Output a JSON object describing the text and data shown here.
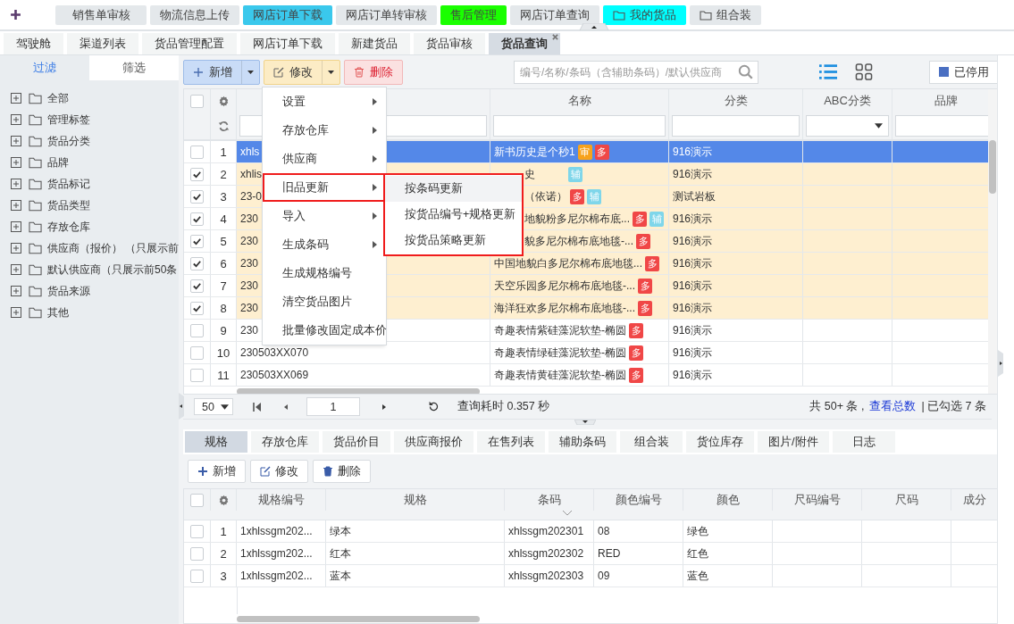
{
  "top_tabs": [
    {
      "label": "销售单审核",
      "kind": "plain",
      "color": "#e4e8eb"
    },
    {
      "label": "物流信息上传",
      "kind": "plain",
      "color": "#e4e8eb"
    },
    {
      "label": "网店订单下载",
      "kind": "plain",
      "color": "#3ac8ec"
    },
    {
      "label": "网店订单转审核",
      "kind": "plain",
      "color": "#e4e8eb"
    },
    {
      "label": "售后管理",
      "kind": "plain",
      "color": "#1aff00"
    },
    {
      "label": "网店订单查询",
      "kind": "plain",
      "color": "#e4e8eb"
    },
    {
      "label": "我的货品",
      "kind": "folder",
      "color": "#00ffff"
    },
    {
      "label": "组合装",
      "kind": "folder",
      "color": "#e4e8eb"
    }
  ],
  "page_tabs": [
    {
      "label": "驾驶舱",
      "selected": false
    },
    {
      "label": "渠道列表",
      "selected": false
    },
    {
      "label": "货品管理配置",
      "selected": false
    },
    {
      "label": "网店订单下载",
      "selected": false
    },
    {
      "label": "新建货品",
      "selected": false
    },
    {
      "label": "货品审核",
      "selected": false
    },
    {
      "label": "货品查询",
      "selected": true
    }
  ],
  "sidebar": {
    "tabs": [
      {
        "label": "过滤",
        "selected": true
      },
      {
        "label": "筛选",
        "selected": false
      }
    ],
    "tree": [
      {
        "label": "全部",
        "expanded": false
      },
      {
        "label": "管理标签",
        "expanded": false
      },
      {
        "label": "货品分类",
        "expanded": false
      },
      {
        "label": "品牌",
        "expanded": false
      },
      {
        "label": "货品标记",
        "expanded": false
      },
      {
        "label": "货品类型",
        "expanded": false
      },
      {
        "label": "存放仓库",
        "expanded": false
      },
      {
        "label": "供应商（报价） （只展示前",
        "expanded": false
      },
      {
        "label": "默认供应商（只展示前50条",
        "expanded": false
      },
      {
        "label": "货品来源",
        "expanded": false
      },
      {
        "label": "其他",
        "expanded": false
      }
    ]
  },
  "toolbar": {
    "buttons": [
      {
        "label": "新增",
        "kind": "add",
        "dropdown": true
      },
      {
        "label": "修改",
        "kind": "edit",
        "dropdown": true
      },
      {
        "label": "删除",
        "kind": "delete",
        "dropdown": false
      }
    ],
    "search": {
      "placeholder": "编号/名称/条码（含辅助条码）/默认供应商"
    },
    "view_modes": [
      {
        "kind": "list",
        "selected": true
      },
      {
        "kind": "grid",
        "selected": false
      }
    ],
    "disabled_toggle": {
      "label": "已停用",
      "checked": true
    }
  },
  "grid": {
    "all_checked": false,
    "columns": [
      {
        "kind": "text"
      },
      {
        "label": "名称",
        "kind": "text"
      },
      {
        "label": "分类",
        "kind": "text"
      },
      {
        "label": "ABC分类",
        "kind": "select"
      },
      {
        "label": "品牌",
        "kind": "text"
      }
    ],
    "rows": [
      {
        "no": "1",
        "code": "xhls",
        "name": "新书历史是个秒1",
        "badges": [
          {
            "label": "审",
            "color": "#f7a21b"
          },
          {
            "label": "多",
            "color": "#f04747"
          }
        ],
        "category": "916演示",
        "checked": false,
        "selected": true
      },
      {
        "no": "2",
        "code": "xhlis",
        "name": "史",
        "badges": [
          {
            "label": "辅",
            "color": "#7fd6ea"
          }
        ],
        "category": "916演示",
        "checked": true,
        "selected": false
      },
      {
        "no": "3",
        "code": "23-0",
        "name": "（依诺）",
        "badges": [
          {
            "label": "多",
            "color": "#f04747"
          },
          {
            "label": "辅",
            "color": "#7fd6ea"
          }
        ],
        "category": "测试岩板",
        "checked": true,
        "selected": false
      },
      {
        "no": "4",
        "code": "230",
        "name": "地貌粉多尼尔棉布底...",
        "badges": [
          {
            "label": "多",
            "color": "#f04747"
          },
          {
            "label": "辅",
            "color": "#7fd6ea"
          }
        ],
        "category": "916演示",
        "checked": true,
        "selected": false
      },
      {
        "no": "5",
        "code": "230",
        "name": "貌多尼尔棉布底地毯-...",
        "badges": [
          {
            "label": "多",
            "color": "#f04747"
          }
        ],
        "category": "916演示",
        "checked": true,
        "selected": false
      },
      {
        "no": "6",
        "code": "230",
        "name": "中国地貌白多尼尔棉布底地毯...",
        "badges": [
          {
            "label": "多",
            "color": "#f04747"
          }
        ],
        "category": "916演示",
        "checked": true,
        "selected": false
      },
      {
        "no": "7",
        "code": "230",
        "name": "天空乐园多尼尔棉布底地毯-...",
        "badges": [
          {
            "label": "多",
            "color": "#f04747"
          }
        ],
        "category": "916演示",
        "checked": true,
        "selected": false
      },
      {
        "no": "8",
        "code": "230",
        "name": "海洋狂欢多尼尔棉布底地毯-...",
        "badges": [
          {
            "label": "多",
            "color": "#f04747"
          }
        ],
        "category": "916演示",
        "checked": true,
        "selected": false
      },
      {
        "no": "9",
        "code": "230",
        "name": "奇趣表情紫硅藻泥软垫-椭圆",
        "badges": [
          {
            "label": "多",
            "color": "#f04747"
          }
        ],
        "category": "916演示",
        "checked": false,
        "selected": false
      },
      {
        "no": "10",
        "code": "230503XX070",
        "name": "奇趣表情绿硅藻泥软垫-椭圆",
        "badges": [
          {
            "label": "多",
            "color": "#f04747"
          }
        ],
        "category": "916演示",
        "checked": false,
        "selected": false
      },
      {
        "no": "11",
        "code": "230503XX069",
        "name": "奇趣表情黄硅藻泥软垫-椭圆",
        "badges": [
          {
            "label": "多",
            "color": "#f04747"
          }
        ],
        "category": "916演示",
        "checked": false,
        "selected": false
      }
    ]
  },
  "context_menu": {
    "items": [
      {
        "label": "设置",
        "submenu": true,
        "highlighted": false
      },
      {
        "label": "存放仓库",
        "submenu": true,
        "highlighted": false
      },
      {
        "label": "供应商",
        "submenu": true,
        "highlighted": false
      },
      {
        "label": "旧品更新",
        "submenu": true,
        "highlighted": true
      },
      {
        "label": "导入",
        "submenu": true,
        "highlighted": false
      },
      {
        "label": "生成条码",
        "submenu": true,
        "highlighted": false
      },
      {
        "label": "生成规格编号",
        "submenu": false,
        "highlighted": false
      },
      {
        "label": "清空货品图片",
        "submenu": false,
        "highlighted": false
      },
      {
        "label": "批量修改固定成本价",
        "submenu": false,
        "highlighted": false
      }
    ]
  },
  "submenu": {
    "highlighted": true,
    "items": [
      {
        "label": "按条码更新",
        "hovered": true
      },
      {
        "label": "按货品编号+规格更新",
        "hovered": false
      },
      {
        "label": "按货品策略更新",
        "hovered": false
      }
    ]
  },
  "pager": {
    "page_size": "50",
    "page": "1",
    "query_time": "查询耗时 0.357 秒",
    "total": "共 50+ 条 ,",
    "total_link": "查看总数",
    "checked_count": "| 已勾选 7 条"
  },
  "detail_tabs": [
    {
      "label": "规格",
      "selected": true
    },
    {
      "label": "存放仓库",
      "selected": false
    },
    {
      "label": "货品价目",
      "selected": false
    },
    {
      "label": "供应商报价",
      "selected": false
    },
    {
      "label": "在售列表",
      "selected": false
    },
    {
      "label": "辅助条码",
      "selected": false
    },
    {
      "label": "组合装",
      "selected": false
    },
    {
      "label": "货位库存",
      "selected": false
    },
    {
      "label": "图片/附件",
      "selected": false
    },
    {
      "label": "日志",
      "selected": false
    }
  ],
  "detail_toolbar": [
    {
      "label": "新增",
      "kind": "add"
    },
    {
      "label": "修改",
      "kind": "edit"
    },
    {
      "label": "删除",
      "kind": "delete"
    }
  ],
  "detail_table": {
    "all_checked": false,
    "columns": [
      "规格编号",
      "规格",
      "条码",
      "颜色编号",
      "颜色",
      "尺码编号",
      "尺码",
      "成分"
    ],
    "rows": [
      {
        "no": "1",
        "checked": false,
        "cells": [
          "1xhlssgm202...",
          "绿本",
          "xhlssgm202301",
          "08",
          "绿色"
        ]
      },
      {
        "no": "2",
        "checked": false,
        "cells": [
          "1xhlssgm202...",
          "红本",
          "xhlssgm202302",
          "RED",
          "红色"
        ]
      },
      {
        "no": "3",
        "checked": false,
        "cells": [
          "1xhlssgm202...",
          "蓝本",
          "xhlssgm202303",
          "09",
          "蓝色"
        ]
      }
    ]
  }
}
